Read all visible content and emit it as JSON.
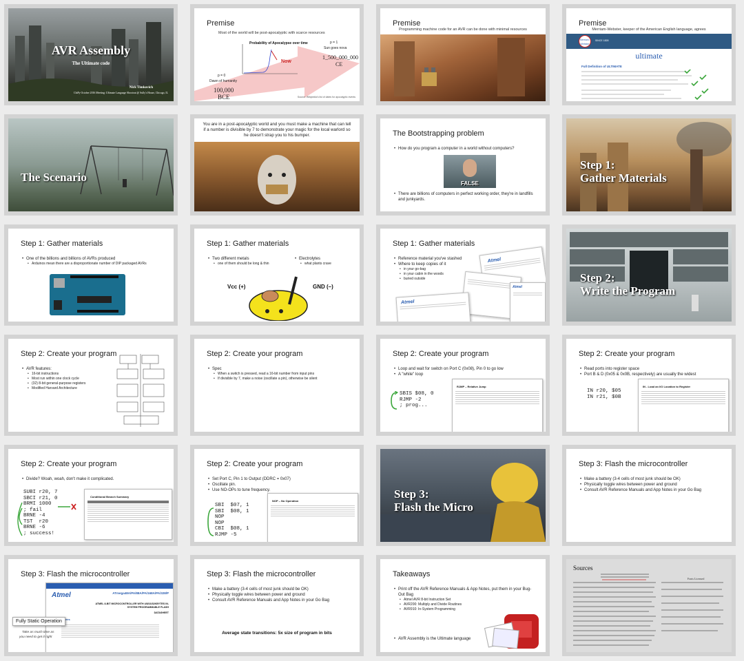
{
  "slides": [
    {
      "title": "AVR Assembly",
      "subtitle": "The Ultimate code",
      "author": "Nick Timkovich",
      "event": "ChiPy October 2016 Meeting: Ultimate Language Shootout @ Sully's House, Chicago, IL"
    },
    {
      "title": "Premise",
      "subtitle": "Most of the world will be post-apocalyptic with scarce resources",
      "chart_title": "Probability of Apocalypse over time",
      "now": "Now",
      "p0": "p = 0",
      "p0_label": "Dawn of humanity",
      "p0_year": "100,000",
      "p0_era": "BCE",
      "p1": "p = 1",
      "p1_label": "Sun goes nova",
      "p1_year": "1_500_000_000",
      "p1_era": "CE",
      "source": "Source: Wikipedia's list of dates for apocalyptic events"
    },
    {
      "title": "Premise",
      "subtitle": "Programming machine code for an AVR can be done with minimal resources"
    },
    {
      "title": "Premise",
      "subtitle": "Merriam-Webster, keeper of the American English language, agrees",
      "brand_top": "Merriam-",
      "brand_bottom": "Webster",
      "since": "SINCE 1828",
      "word": "ultimate",
      "defs_heading": "Full Definition of ULTIMATE"
    },
    {
      "title": "The Scenario"
    },
    {
      "text": "You are in a post-apocalyptic world and you must make a machine that can tell if a number is divisible by 7 to demonstrate your magic for the local warlord so he doesn't strap you to his bumper."
    },
    {
      "title": "The Bootstrapping problem",
      "bullet1": "How do you program a computer in a world without computers?",
      "meme": "FALSE",
      "bullet2": "There are billions of computers in perfect working order, they're in landfills and junkyards."
    },
    {
      "title": "Step 1:",
      "title2": "Gather Materials"
    },
    {
      "title": "Step 1: Gather materials",
      "bullet1": "One of the billions and billions of AVRs produced",
      "sub1": "Arduinos mean there are a disproportionate number of DIP packaged AVRs"
    },
    {
      "title": "Step 1: Gather materials",
      "bullet1": "Two different metals",
      "sub1": "one of them should be long & thin",
      "bullet2": "Electrolytes",
      "sub2": "what plants crave",
      "vcc": "Vcc (+)",
      "gnd": "GND (–)"
    },
    {
      "title": "Step 1: Gather materials",
      "bullet1": "Reference material you've stashed",
      "bullet2": "Where to keep copies of it",
      "sub1": "in your go-bag",
      "sub2": "in your cabin in the woods",
      "sub3": "buried outside",
      "brand": "Atmel"
    },
    {
      "title": "Step 2:",
      "title2": "Write the Program"
    },
    {
      "title": "Step 2: Create your program",
      "bullet1": "AVR features:",
      "subs": [
        "16-bit instructions",
        "Most run within one clock cycle",
        "(32) 8-bit general-purpose registers",
        "Modified Harvard Architecture"
      ]
    },
    {
      "title": "Step 2: Create your program",
      "bullet1": "Spec",
      "subs": [
        "When a switch is pressed, read a 16-bit number from input pins",
        "If divisible by 7, make a noise (oscillate a pin), otherwise be silent"
      ]
    },
    {
      "title": "Step 2: Create your program",
      "bullet1": "Loop and wait for switch on Port C (0x08), Pin 0 to go low",
      "bullet2": "A \"while\" loop",
      "code": "SBIS $08, 0\nRJMP -2\n; prog...",
      "doc_heading": "RJMP – Relative Jump"
    },
    {
      "title": "Step 2: Create your program",
      "bullet1": "Read ports into register space",
      "bullet2": "Port B & D (0x05 & 0x0B, respectively) are usually the widest",
      "code": "IN r20, $05\nIN r21, $0B",
      "doc_heading": "IN - Load an I/O Location to Register"
    },
    {
      "title": "Step 2: Create your program",
      "bullet1": "Divide? Woah, woah, don't make it complicated.",
      "code": "SUBI r20, 7\nSBCI r21, 0\nBRMI 1000\n; fail\nBRNE -4\nTST  r20\nBRNE -6\n; success!",
      "doc_heading": "Conditional Branch Summary"
    },
    {
      "title": "Step 2: Create your program",
      "bullets": [
        "Set Port C, Pin 1 to Output (DDRC = 0x07)",
        "Oscillate pin.",
        "Use NO-OPs to tune frequency."
      ],
      "code": "SBI  $07, 1\nSBI  $08, 1\nNOP\nNOP\nCBI  $08, 1\nRJMP -5",
      "doc_heading": "NOP – No Operation"
    },
    {
      "title": "Step 3:",
      "title2": "Flash the Micro"
    },
    {
      "title": "Step 3: Flash the microcontroller",
      "bullets": [
        "Make a battery (3-4 cells of most junk should be OK)",
        "Physically toggle wires between power and ground",
        "Consult AVR Reference Manuals and App Notes in your Go Bag"
      ]
    },
    {
      "title": "Step 3: Flash the microcontroller",
      "brand": "Atmel",
      "part": "ATmega48A/PA/88A/PA/168A/PA/328/P",
      "headline": "ATMEL 8-BIT MICROCONTROLLER WITH 4/8/16/32KBYTES IN-SYSTEM PROGRAMMABLE FLASH",
      "datasheet": "DATASHEET",
      "features": "Features",
      "callout": "Fully Static Operation",
      "caption1": "Take as much time as",
      "caption2": "you need to get it right"
    },
    {
      "title": "Step 3: Flash the microcontroller",
      "bullets": [
        "Make a battery (3-4 cells of most junk should be OK)",
        "Physically toggle wires between power and ground",
        "Consult AVR Reference Manuals and App Notes in your Go Bag"
      ],
      "footer": "Average state transitions: 5x size of program in bits"
    },
    {
      "title": "Takeaways",
      "bullet1": "Print off the AVR Reference Manuals & App Notes, put them in your Bug-Out Bag",
      "subs": [
        "Atmel AVR 8-bit Instruction Set",
        "AVR200: Multiply and Divide Routines",
        "AVR910: In-System Programming"
      ],
      "bullet2": "AVR Assembly is the Ultimate language"
    },
    {
      "title": "Sources",
      "right_heading": "Fonts Licensed"
    }
  ],
  "colors": {
    "cell_border": "#d3d3d3",
    "page_bg": "#ececec",
    "atmel_blue": "#2a5db0",
    "now_red": "#cc2222",
    "check_green": "#3aa63a"
  }
}
